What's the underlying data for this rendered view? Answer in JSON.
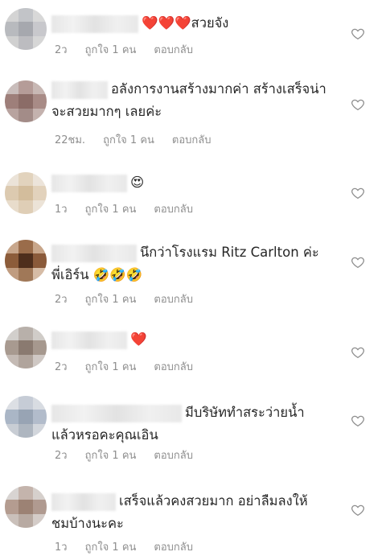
{
  "comments": [
    {
      "text": "❤️❤️❤️สวยจัง",
      "line2": "",
      "time": "2ว",
      "likes": "ถูกใจ 1 คน",
      "reply": "ตอบกลับ"
    },
    {
      "text": "อลังการงานสร้างมากค่า สร้างเสร็จน่า",
      "line2": "จะสวยมากๆ เลยค่ะ",
      "time": "22ชม.",
      "likes": "ถูกใจ 1 คน",
      "reply": "ตอบกลับ"
    },
    {
      "text": "😍",
      "line2": "",
      "time": "1ว",
      "likes": "ถูกใจ 1 คน",
      "reply": "ตอบกลับ"
    },
    {
      "text": "นึกว่าโรงแรม Ritz Carlton ค่ะ",
      "line2": "พี่เอิร์น 🤣🤣🤣",
      "time": "2ว",
      "likes": "ถูกใจ 1 คน",
      "reply": "ตอบกลับ"
    },
    {
      "text": "❤️",
      "line2": "",
      "time": "2ว",
      "likes": "ถูกใจ 1 คน",
      "reply": "ตอบกลับ"
    },
    {
      "text": "มีบริษัททำสระว่ายน้ำ",
      "line2": "แล้วหรอคะคุณเอิน",
      "time": "2ว",
      "likes": "ถูกใจ 1 คน",
      "reply": "ตอบกลับ"
    },
    {
      "text": "เสร็จแล้วคงสวยมาก  อย่าลืมลงให้",
      "line2": "ชมบ้างนะคะ",
      "time": "1ว",
      "likes": "ถูกใจ 1 คน",
      "reply": "ตอบกลับ"
    }
  ],
  "colors": {
    "text": "#262626",
    "meta": "#8e8e8e",
    "heart_outline": "#8e8e8e",
    "emoji_heart": "#e0245e"
  },
  "icons": {
    "like": "heart-outline-icon"
  }
}
